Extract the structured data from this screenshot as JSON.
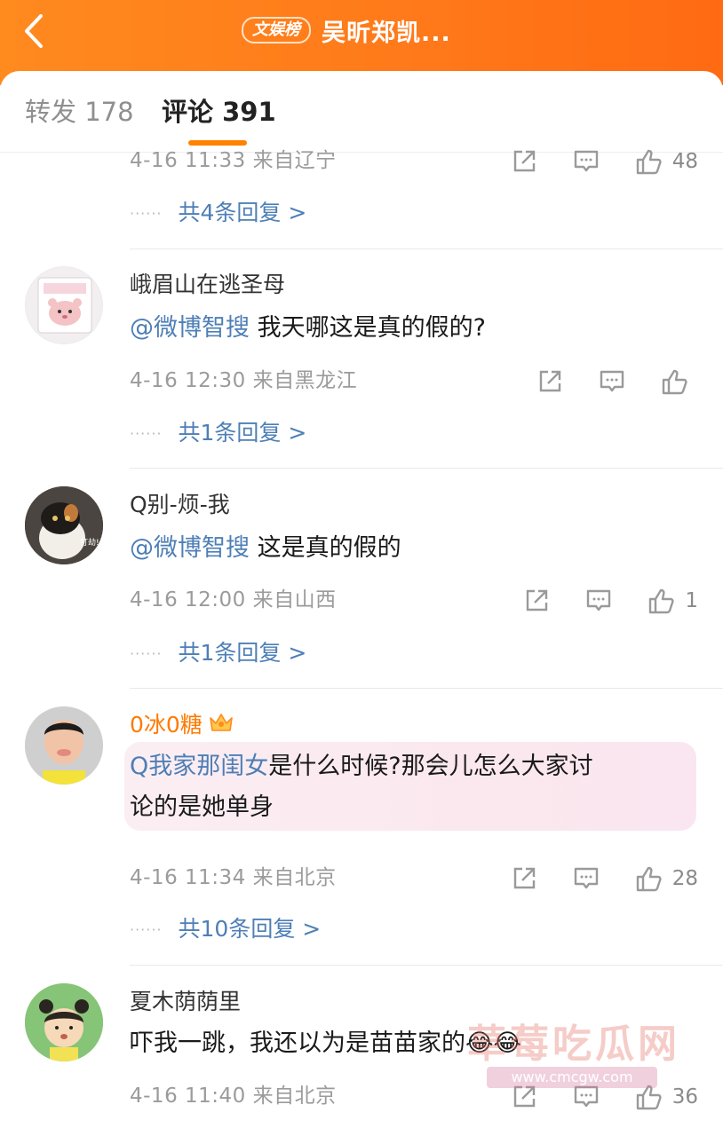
{
  "header": {
    "back_icon": "chevron-left-icon",
    "tag": "文娱榜",
    "title": "吴昕郑凯..."
  },
  "tabs": {
    "repost": "转发 178",
    "comment": "评论 391"
  },
  "comments": [
    {
      "meta": "4-16 11:33  来自辽宁",
      "likes": "48",
      "replies": "共4条回复 >"
    },
    {
      "name": "峨眉山在逃圣母",
      "mention": "@微博智搜",
      "text": "  我天哪这是真的假的?",
      "meta": "4-16 12:30  来自黑龙江",
      "likes": "",
      "replies": "共1条回复 >"
    },
    {
      "name": "Q别-烦-我",
      "mention": "@微博智搜",
      "text": " 这是真的假的",
      "meta": "4-16 12:00  来自山西",
      "likes": "1",
      "replies": "共1条回复 >"
    },
    {
      "name": "0冰0糖",
      "search_link": "我家那闺女",
      "text_line1": "是什么时候?那会儿怎么大家讨",
      "text_line2": "论的是她单身",
      "meta": "4-16 11:34  来自北京",
      "likes": "28",
      "replies": "共10条回复 >"
    },
    {
      "name": "夏木荫荫里",
      "text": "吓我一跳，我还以为是苗苗家的",
      "emoji": "😂😂",
      "meta": "4-16 11:40  来自北京",
      "likes": "36"
    }
  ],
  "icons": {
    "share": "share-icon",
    "comment": "comment-icon",
    "like": "thumbs-up-icon"
  },
  "colors": {
    "header": "#ff7a1a",
    "accent": "#ff8200",
    "link": "#4e7fb6"
  },
  "watermark": {
    "text": "草莓吃瓜网",
    "url": "www.cmcgw.com"
  }
}
